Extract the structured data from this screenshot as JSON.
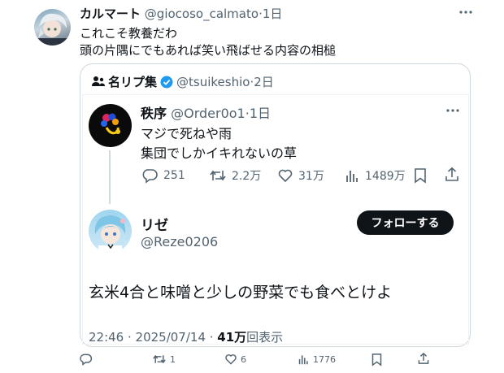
{
  "post": {
    "display_name": "カルマート",
    "handle": "@giocoso_calmato",
    "time": "1日",
    "text_line1": "これこそ教養だわ",
    "text_line2": "頭の片隅にでもあれば笑い飛ばせる内容の相槌"
  },
  "quote": {
    "display_name": "名リプ集",
    "handle": "@tsuikeshio",
    "time": "2日"
  },
  "reply_post": {
    "display_name": "秩序",
    "handle": "@Order0o1",
    "time": "1日",
    "text_line1": "マジで死ねや雨",
    "text_line2": "集団でしかイキれないの草",
    "stats": {
      "replies": "251",
      "reposts": "2.2万",
      "likes": "31万",
      "views": "1489万"
    }
  },
  "answer_post": {
    "display_name": "リゼ",
    "handle": "@Reze0206",
    "follow_label": "フォローする",
    "text": "玄米4合と味噌と少しの野菜でも食べとけよ",
    "timestamp": "22:46 · 2025/07/14 · ",
    "view_count": "41万",
    "view_label": "回表示"
  },
  "actions": {
    "replies": "",
    "reposts": "1",
    "likes": "6",
    "views": "1776"
  },
  "colors": {
    "verified": "#1d9bf0",
    "text": "#0f1419",
    "muted": "#536471",
    "border": "#cfd9de"
  },
  "icons": [
    "more-icon",
    "community-icon",
    "verified-badge-icon",
    "reply-icon",
    "repost-icon",
    "like-icon",
    "views-icon",
    "bookmark-icon",
    "share-icon"
  ]
}
